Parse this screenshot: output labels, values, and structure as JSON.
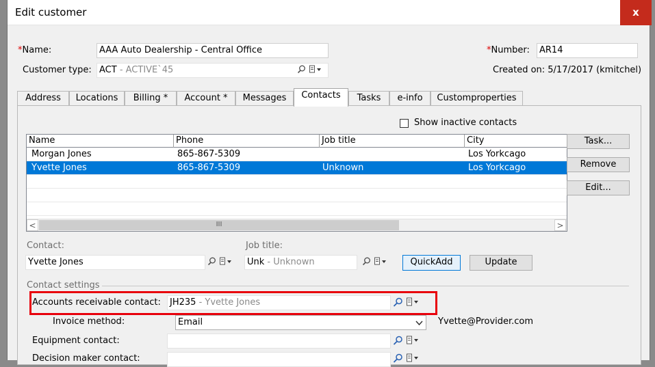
{
  "window": {
    "title": "Edit customer",
    "close_glyph": "x"
  },
  "header": {
    "name_label": "Name:",
    "name_value": "AAA Auto Dealership - Central Office",
    "number_label": "Number:",
    "number_value": "AR14",
    "customer_type_label": "Customer type:",
    "customer_type_code": "ACT",
    "customer_type_desc": " - ACTIVE`45",
    "created_on": "Created on: 5/17/2017 (kmitchel)",
    "required_mark": "*"
  },
  "tabs": [
    {
      "label": "Address"
    },
    {
      "label": "Locations"
    },
    {
      "label": "Billing *"
    },
    {
      "label": "Account *"
    },
    {
      "label": "Messages"
    },
    {
      "label": "Contacts"
    },
    {
      "label": "Tasks"
    },
    {
      "label": "e-info"
    },
    {
      "label": "Customproperties"
    }
  ],
  "active_tab": "Contacts",
  "contacts": {
    "show_inactive_label": "Show inactive contacts",
    "columns": [
      "Name",
      "Phone",
      "Job title",
      "City"
    ],
    "rows": [
      {
        "name": "Morgan Jones",
        "phone": "865-867-5309",
        "job": "",
        "city": "Los Yorkcago"
      },
      {
        "name": "Yvette Jones",
        "phone": "865-867-5309",
        "job": "Unknown",
        "city": "Los Yorkcago"
      }
    ],
    "scroll_left": "<",
    "scroll_right": ">",
    "scroll_thumb": "III",
    "buttons": {
      "task": "Task...",
      "remove": "Remove",
      "edit": "Edit..."
    },
    "contact_label": "Contact:",
    "contact_value": "Yvette Jones",
    "job_title_label": "Job title:",
    "job_code": "Unk",
    "job_desc": " - Unknown",
    "quickadd": "QuickAdd",
    "update": "Update"
  },
  "settings": {
    "section_label": "Contact settings",
    "ar_contact_label": "Accounts receivable contact:",
    "ar_code": "JH235",
    "ar_desc": " - Yvette Jones",
    "invoice_method_label": "Invoice method:",
    "invoice_method_value": "Email",
    "invoice_email": "Yvette@Provider.com",
    "equipment_label": "Equipment contact:",
    "decision_label": "Decision maker contact:"
  },
  "icons": {
    "lookup": "search-icon",
    "menu": "drop-menu-icon",
    "chevron": "chevron-down-icon"
  },
  "colors": {
    "selection": "#0078d7",
    "highlight": "#e8000b",
    "close": "#c42b1c",
    "required": "#dd0000"
  }
}
